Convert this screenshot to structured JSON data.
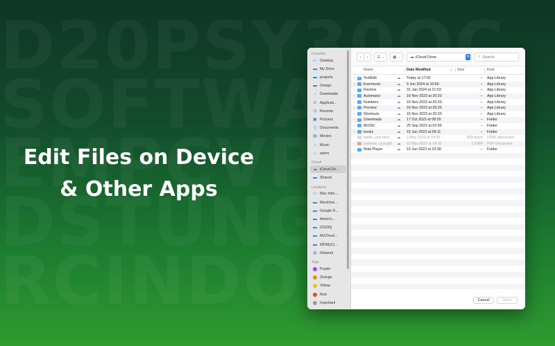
{
  "headline": {
    "line1": "Edit Files on Device",
    "line2": "& Other Apps"
  },
  "background_letters": [
    "D20PSY30OC",
    "SOFTWAREB",
    "EMPCVPROG",
    "DSTUNGRA",
    "RCINDOSK"
  ],
  "sidebar": {
    "favorites_heading": "Favorites",
    "favorites": [
      {
        "label": "Desktop",
        "icon": "desktop-icon"
      },
      {
        "label": "My Drive",
        "icon": "folder-icon"
      },
      {
        "label": "projects",
        "icon": "folder-icon"
      },
      {
        "label": "Design",
        "icon": "folder-icon"
      },
      {
        "label": "Downloads",
        "icon": "download-icon"
      },
      {
        "label": "Applicati...",
        "icon": "applications-icon"
      },
      {
        "label": "Recents",
        "icon": "clock-icon"
      },
      {
        "label": "Pictures",
        "icon": "photo-icon"
      },
      {
        "label": "Documents",
        "icon": "document-icon"
      },
      {
        "label": "Movies",
        "icon": "film-icon"
      },
      {
        "label": "Music",
        "icon": "music-icon"
      },
      {
        "label": "artem",
        "icon": "home-icon"
      }
    ],
    "icloud_heading": "iCloud",
    "icloud": [
      {
        "label": "iCloud Dri...",
        "icon": "cloud-icon"
      },
      {
        "label": "Shared",
        "icon": "shared-folder-icon"
      }
    ],
    "locations_heading": "Locations",
    "locations": [
      {
        "label": "Mac mini...",
        "icon": "computer-icon"
      },
      {
        "label": "Macintos...",
        "icon": "disk-icon"
      },
      {
        "label": "Google D...",
        "icon": "disk-icon"
      },
      {
        "label": "Artem's...",
        "icon": "network-drive-icon"
      },
      {
        "label": "DS220j",
        "icon": "network-drive-icon"
      },
      {
        "label": "MyCloud...",
        "icon": "network-drive-icon"
      },
      {
        "label": "WDMyCl...",
        "icon": "network-drive-icon"
      },
      {
        "label": "Network",
        "icon": "globe-icon"
      }
    ],
    "tags_heading": "Tags",
    "tags": [
      {
        "label": "Purple",
        "color": "#9b4dd6"
      },
      {
        "label": "Orange",
        "color": "#f08a24"
      },
      {
        "label": "Yellow",
        "color": "#f2c21b"
      },
      {
        "label": "Red",
        "color": "#e5433a"
      },
      {
        "label": "Important",
        "color": "#9a9a9a"
      }
    ]
  },
  "toolbar": {
    "back": "‹",
    "forward": "›",
    "list_view": "☰",
    "grid_view": "▦",
    "location": "iCloud Drive",
    "search_placeholder": "Search"
  },
  "columns": {
    "name": "Name",
    "date": "Date Modified",
    "size": "Size",
    "kind": "Kind"
  },
  "files": [
    {
      "name": "TextEdit",
      "date": "Today at 17:02",
      "size": "--",
      "kind": "App Library",
      "type": "folder",
      "dim": false
    },
    {
      "name": "Evermusic",
      "date": "9 Jun 2024 at 10:56",
      "size": "--",
      "kind": "App Library",
      "type": "folder",
      "dim": false
    },
    {
      "name": "Flacbox",
      "date": "31 Jan 2024 at 21:03",
      "size": "--",
      "kind": "App Library",
      "type": "folder",
      "dim": false
    },
    {
      "name": "Automator",
      "date": "16 Nov 2023 at 20:20",
      "size": "--",
      "kind": "App Library",
      "type": "folder",
      "dim": false
    },
    {
      "name": "Numbers",
      "date": "16 Nov 2023 at 20:20",
      "size": "--",
      "kind": "App Library",
      "type": "folder",
      "dim": false
    },
    {
      "name": "Preview",
      "date": "16 Nov 2023 at 20:20",
      "size": "--",
      "kind": "App Library",
      "type": "folder",
      "dim": false
    },
    {
      "name": "Shortcuts",
      "date": "16 Nov 2023 at 20:20",
      "size": "--",
      "kind": "App Library",
      "type": "folder",
      "dim": false
    },
    {
      "name": "Downloads",
      "date": "17 Oct 2023 at 08:29",
      "size": "--",
      "kind": "Folder",
      "type": "folder",
      "dim": false
    },
    {
      "name": "MUSIC",
      "date": "25 Sep 2023 at 02:49",
      "size": "--",
      "kind": "Folder",
      "type": "folder",
      "dim": false
    },
    {
      "name": "books",
      "date": "15 Jun 2023 at 09:11",
      "size": "--",
      "kind": "Folder",
      "type": "folder",
      "dim": false
    },
    {
      "name": "twitter_test.html",
      "date": "2 May 2023 at 14:30",
      "size": "833 bytes",
      "kind": "HTML document",
      "type": "doc",
      "dim": true
    },
    {
      "name": "autoriza...ucir.pdf",
      "date": "10 Mar 2023 at 14:10",
      "size": "1,8 MB",
      "kind": "PDF Document",
      "type": "pdf",
      "dim": true
    },
    {
      "name": "Nota Player",
      "date": "15 Jun 2022 at 23:38",
      "size": "--",
      "kind": "Folder",
      "type": "folder",
      "dim": false
    }
  ],
  "empty_rows": 28,
  "footer": {
    "cancel": "Cancel",
    "open": "Open"
  }
}
